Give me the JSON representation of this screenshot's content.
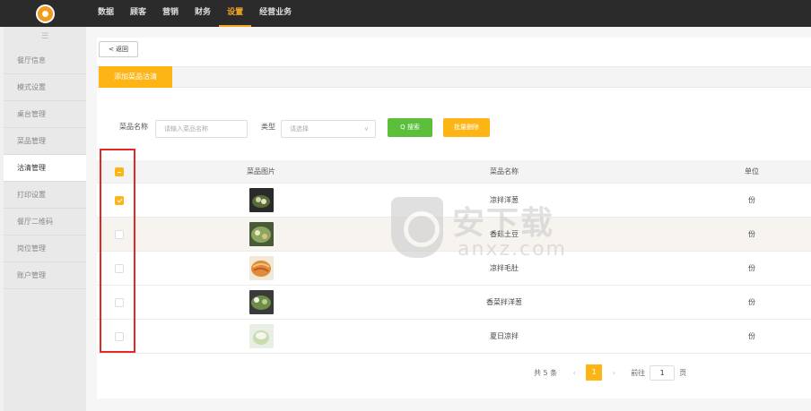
{
  "top_nav": [
    "数据",
    "顾客",
    "营销",
    "财务",
    "设置",
    "经营业务"
  ],
  "top_nav_active": "设置",
  "sidebar": {
    "toggle": "☰",
    "items": [
      "餐厅信息",
      "模式设置",
      "桌台管理",
      "菜品管理",
      "沽清管理",
      "打印设置",
      "餐厅二维码",
      "岗位管理",
      "账户管理"
    ],
    "active": "沽清管理"
  },
  "back_label": "< 返回",
  "tab_label": "添加菜品沽清",
  "search": {
    "name_label": "菜品名称",
    "name_placeholder": "请输入菜品名称",
    "type_label": "类型",
    "type_placeholder": "请选择",
    "search_button": "Q 搜索",
    "batch_button": "批量删除"
  },
  "table": {
    "headers": [
      "菜品图片",
      "菜品名称",
      "单位"
    ],
    "rows": [
      {
        "name": "凉拌洋葱",
        "unit": "份",
        "checked": true
      },
      {
        "name": "香菇土豆",
        "unit": "份",
        "checked": false
      },
      {
        "name": "凉拌毛肚",
        "unit": "份",
        "checked": false
      },
      {
        "name": "香菜拌洋葱",
        "unit": "份",
        "checked": false
      },
      {
        "name": "夏日凉拌",
        "unit": "份",
        "checked": false
      }
    ]
  },
  "pagination": {
    "total_text": "共 5 条",
    "prev": "‹",
    "current_page": "1",
    "next": "›",
    "goto_label": "前往",
    "goto_value": "1",
    "page_suffix": "页"
  },
  "watermark": {
    "cn": "安下载",
    "en": "anxz.com"
  },
  "colors": {
    "accent": "#fdb515",
    "search_green": "#5bbf3c",
    "highlight_red": "#e02a2a",
    "topbar": "#2b2b2b"
  }
}
